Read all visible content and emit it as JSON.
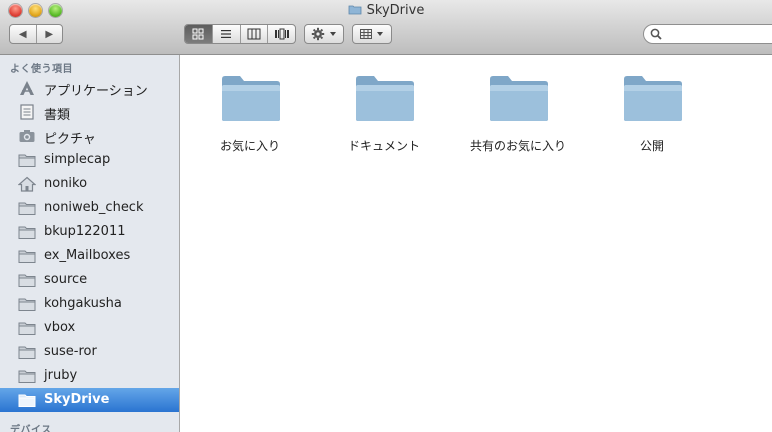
{
  "window": {
    "title": "SkyDrive"
  },
  "toolbar": {
    "back_glyph": "◀",
    "forward_glyph": "▶",
    "search_placeholder": ""
  },
  "sidebar": {
    "favorites_heading": "よく使う項目",
    "devices_heading": "デバイス",
    "items": [
      {
        "label": "アプリケーション",
        "icon": "applications-icon"
      },
      {
        "label": "書類",
        "icon": "documents-icon"
      },
      {
        "label": "ピクチャ",
        "icon": "camera-icon"
      },
      {
        "label": "simplecap",
        "icon": "folder-icon"
      },
      {
        "label": "noniko",
        "icon": "home-icon"
      },
      {
        "label": "noniweb_check",
        "icon": "folder-icon"
      },
      {
        "label": "bkup122011",
        "icon": "folder-icon"
      },
      {
        "label": "ex_Mailboxes",
        "icon": "folder-icon"
      },
      {
        "label": "source",
        "icon": "folder-icon"
      },
      {
        "label": "kohgakusha",
        "icon": "folder-icon"
      },
      {
        "label": "vbox",
        "icon": "folder-icon"
      },
      {
        "label": "suse-ror",
        "icon": "folder-icon"
      },
      {
        "label": "jruby",
        "icon": "folder-icon"
      },
      {
        "label": "SkyDrive",
        "icon": "folder-icon",
        "selected": true
      }
    ]
  },
  "content": {
    "folders": [
      {
        "name": "お気に入り"
      },
      {
        "name": "ドキュメント"
      },
      {
        "name": "共有のお気に入り"
      },
      {
        "name": "公開"
      }
    ]
  },
  "colors": {
    "selection": "#2a74d1",
    "sidebar_bg": "#e4e8ee",
    "folder_blue": "#9cc0dc"
  }
}
